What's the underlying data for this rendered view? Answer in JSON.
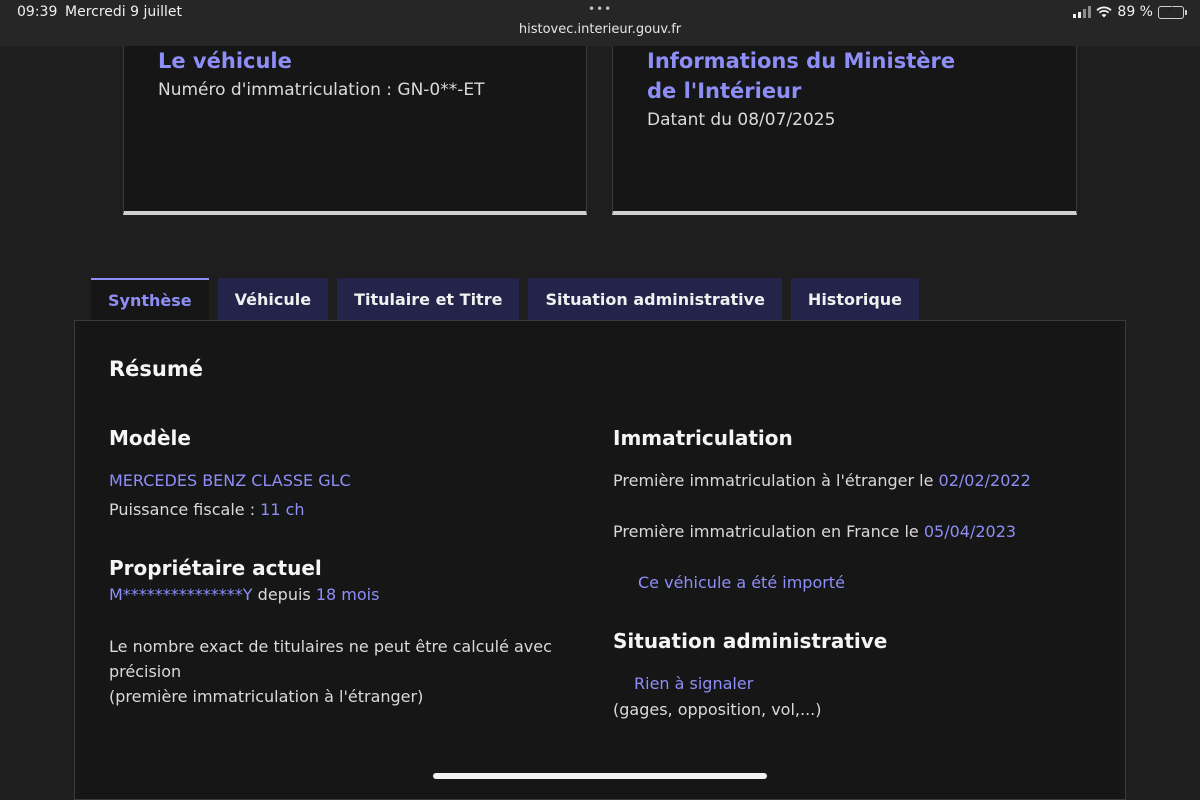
{
  "status_bar": {
    "time": "09:39",
    "date": "Mercredi 9 juillet",
    "dots": "•••",
    "url": "histovec.interieur.gouv.fr",
    "battery": "89 %"
  },
  "cards": {
    "vehicle": {
      "title": "Le véhicule",
      "plate_text": "Numéro d'immatriculation : GN-0**-ET"
    },
    "ministry": {
      "title": "Informations du Ministère de l'Intérieur",
      "date_text": "Datant du 08/07/2025"
    }
  },
  "tabs": [
    {
      "label": "Synthèse",
      "active": true
    },
    {
      "label": "Véhicule",
      "active": false
    },
    {
      "label": "Titulaire et Titre",
      "active": false
    },
    {
      "label": "Situation administrative",
      "active": false
    },
    {
      "label": "Historique",
      "active": false
    }
  ],
  "summary": {
    "heading": "Résumé",
    "model": {
      "heading": "Modèle",
      "name": "MERCEDES BENZ CLASSE GLC",
      "power_label": "Puissance fiscale : ",
      "power_value": "11 ch"
    },
    "owner": {
      "heading": "Propriétaire actuel",
      "name": "M***************Y",
      "since_label": " depuis ",
      "since_value": "18 mois",
      "note_line1": "Le nombre exact de titulaires ne peut être calculé avec précision",
      "note_line2": "(première immatriculation à l'étranger)"
    },
    "registration": {
      "heading": "Immatriculation",
      "foreign_label": "Première immatriculation à l'étranger le ",
      "foreign_date": "02/02/2022",
      "france_label": "Première immatriculation en France le ",
      "france_date": "05/04/2023",
      "imported": "Ce véhicule a été importé"
    },
    "admin": {
      "heading": "Situation administrative",
      "status": "Rien à signaler",
      "details": "(gages, opposition, vol,...)"
    }
  }
}
